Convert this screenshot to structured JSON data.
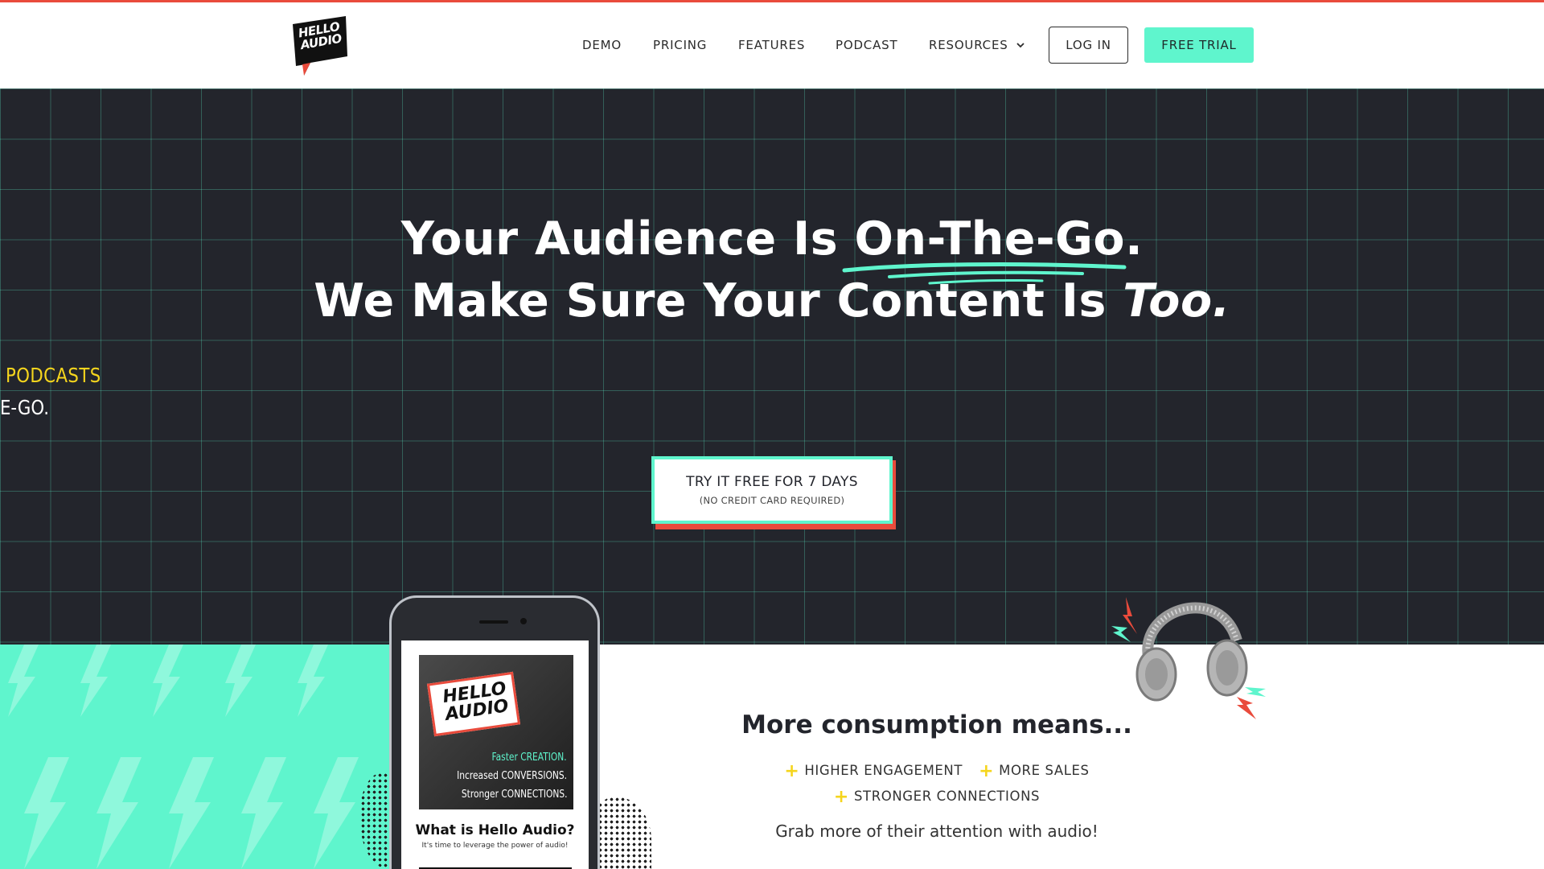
{
  "brand": {
    "logo_text": "HELLO AUDIO",
    "colors": {
      "mint": "#5ff5cd",
      "coral": "#e94b3c",
      "yellow": "#f5d51d",
      "dark": "#23252c"
    }
  },
  "nav": {
    "items": [
      {
        "label": "DEMO"
      },
      {
        "label": "PRICING"
      },
      {
        "label": "FEATURES"
      },
      {
        "label": "PODCAST"
      },
      {
        "label": "RESOURCES"
      }
    ],
    "login_label": "LOG IN",
    "trial_label": "FREE TRIAL"
  },
  "hero": {
    "line1_prefix": "Your Audience Is ",
    "line1_highlight": "On-The-Go.",
    "line2_prefix": "We Make Sure Your Content Is ",
    "line2_emphasis": "Too.",
    "side_text_1": "PODCASTS",
    "side_text_2": "E-GO.",
    "cta_main": "TRY IT FREE FOR 7 DAYS",
    "cta_sub": "(NO CREDIT CARD REQUIRED)"
  },
  "phone": {
    "logo_text": "HELLO AUDIO",
    "tag_1": "Faster CREATION.",
    "tag_2": "Increased CONVERSIONS.",
    "tag_3": "Stronger CONNECTIONS.",
    "title": "What is Hello Audio?",
    "subtitle": "It's time to leverage the power of audio!"
  },
  "consumption": {
    "title": "More consumption means...",
    "benefits": [
      "HIGHER ENGAGEMENT",
      "MORE SALES",
      "STRONGER CONNECTIONS"
    ],
    "tagline": "Grab more of their attention with audio!"
  }
}
